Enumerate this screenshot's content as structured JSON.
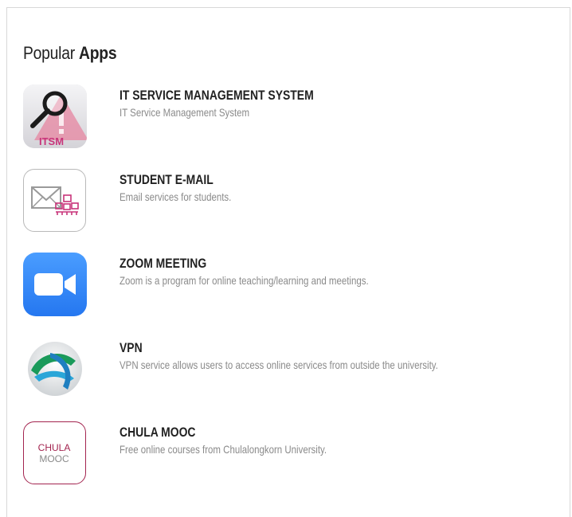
{
  "section": {
    "title_prefix": "Popular ",
    "title_bold": "Apps"
  },
  "apps": [
    {
      "name": "IT SERVICE MANAGEMENT SYSTEM",
      "description": "IT Service Management System",
      "icon": "itsm-icon",
      "icon_text": "ITSM"
    },
    {
      "name": "STUDENT E-MAIL",
      "description": "Email services for students.",
      "icon": "student-email-icon"
    },
    {
      "name": "ZOOM MEETING",
      "description": "Zoom is a program for online teaching/learning and meetings.",
      "icon": "zoom-icon"
    },
    {
      "name": "VPN",
      "description": "VPN service allows users to access online services from outside the university.",
      "icon": "vpn-icon"
    },
    {
      "name": "CHULA MOOC",
      "description": "Free online courses from Chulalongkorn University.",
      "icon": "chula-mooc-icon",
      "icon_text_line1": "CHULA",
      "icon_text_line2": "MOOC"
    }
  ],
  "colors": {
    "pink_accent": "#c8347a",
    "zoom_blue": "#2d8cff",
    "mooc_maroon": "#a3244f"
  }
}
